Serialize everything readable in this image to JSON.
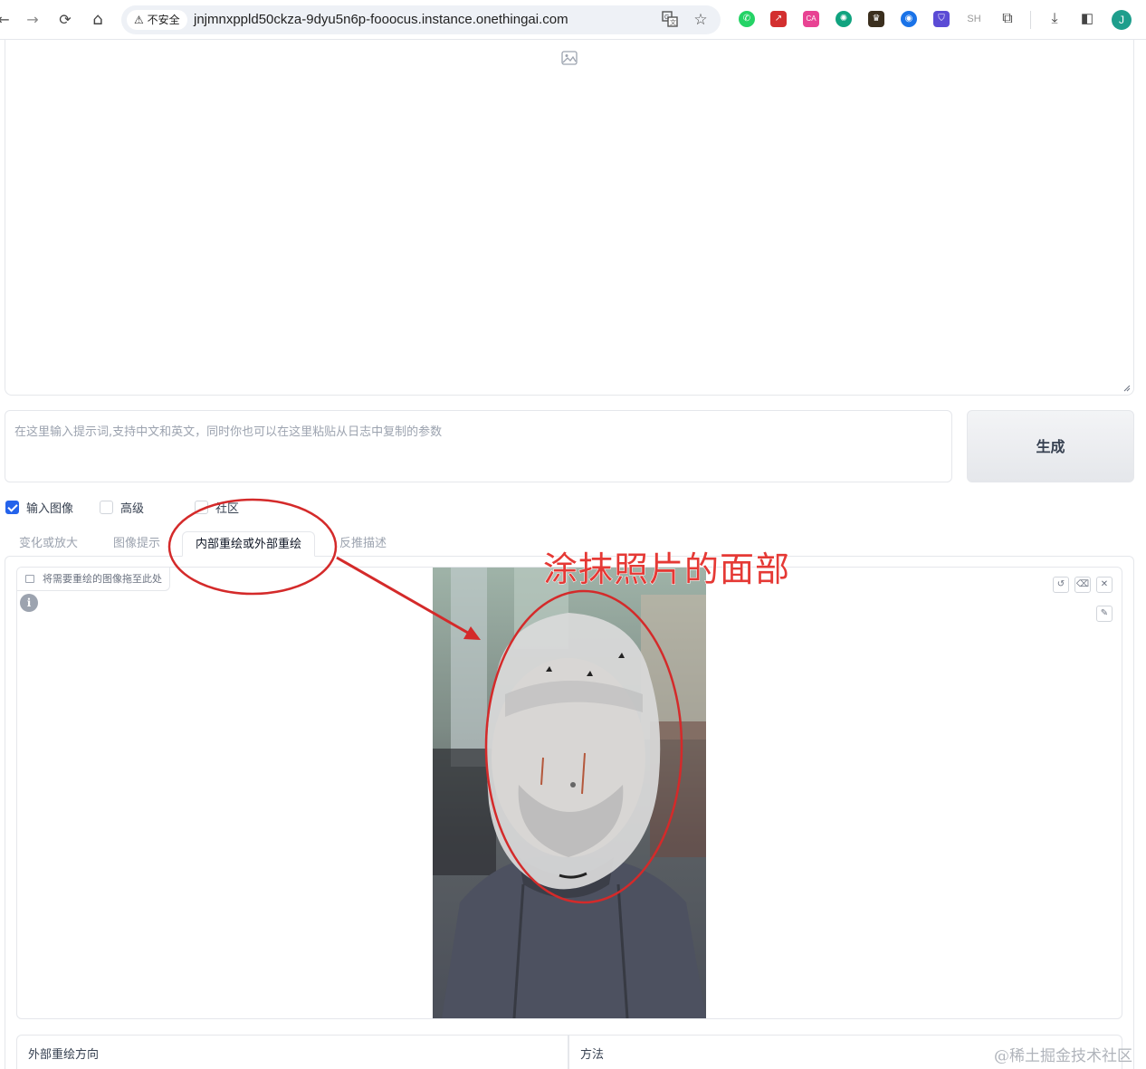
{
  "browser": {
    "back": "←",
    "forward": "→",
    "reload": "⟳",
    "home": "⌂",
    "security_label": "不安全",
    "url": "jnjmnxppld50ckza-9dyu5n6p-fooocus.instance.onethingai.com",
    "extensions": [
      "whatsapp-icon",
      "pdf-icon",
      "translate-ca-icon",
      "chatgpt-icon",
      "extension-icon",
      "globe-icon",
      "shield-icon",
      "SH"
    ],
    "sh_label": "SH",
    "avatar_letter": "J"
  },
  "prompt": {
    "placeholder": "在这里输入提示词,支持中文和英文，同时你也可以在这里粘贴从日志中复制的参数"
  },
  "generate_label": "生成",
  "options": [
    {
      "label": "输入图像",
      "checked": true
    },
    {
      "label": "高级",
      "checked": false
    },
    {
      "label": "社区",
      "checked": false
    }
  ],
  "tabs": [
    {
      "label": "变化或放大",
      "active": false
    },
    {
      "label": "图像提示",
      "active": false
    },
    {
      "label": "内部重绘或外部重绘",
      "active": true
    },
    {
      "label": "反推描述",
      "active": false
    }
  ],
  "editor": {
    "drop_label": "将需要重绘的图像拖至此处",
    "info": "i"
  },
  "outpaint_direction_label": "外部重绘方向",
  "method_label": "方法",
  "annotation_text": "涂抹照片的面部",
  "watermark": "@稀土掘金技术社区"
}
